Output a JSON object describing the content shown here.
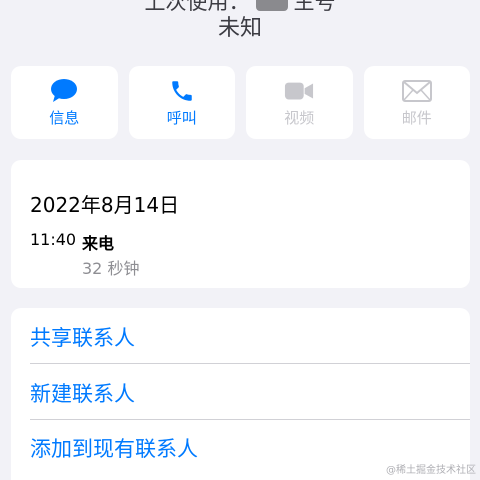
{
  "header": {
    "last_used": "上次使用：",
    "last_used_sim": "主号",
    "subtitle": "未知"
  },
  "actions": [
    {
      "label": "信息",
      "icon": "message-icon",
      "enabled": true
    },
    {
      "label": "呼叫",
      "icon": "phone-icon",
      "enabled": true
    },
    {
      "label": "视频",
      "icon": "video-icon",
      "enabled": false
    },
    {
      "label": "邮件",
      "icon": "mail-icon",
      "enabled": false
    }
  ],
  "call_info": {
    "date": "2022年8月14日",
    "time": "11:40",
    "type": "来电",
    "duration": "32 秒钟"
  },
  "contact_actions": [
    {
      "label": "共享联系人"
    },
    {
      "label": "新建联系人"
    },
    {
      "label": "添加到现有联系人"
    }
  ],
  "watermark": "@稀土掘金技术社区",
  "colors": {
    "accent": "#007aff",
    "disabled": "#c7c7cc",
    "background": "#f2f2f7"
  }
}
